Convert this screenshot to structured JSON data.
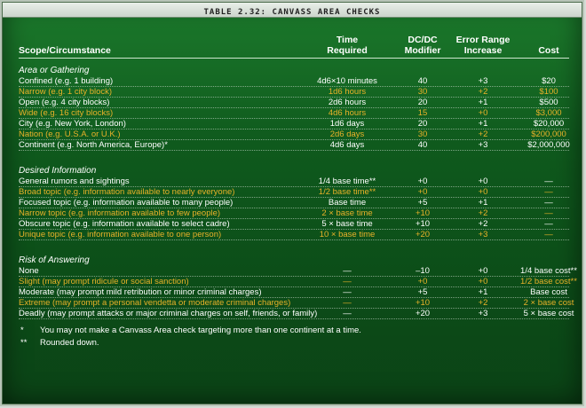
{
  "title": "TABLE 2.32: CANVASS AREA CHECKS",
  "headers": [
    [
      "Scope/Circumstance"
    ],
    [
      "Time",
      "Required"
    ],
    [
      "DC/DC",
      "Modifier"
    ],
    [
      "Error Range",
      "Increase"
    ],
    [
      "Cost"
    ]
  ],
  "sections": [
    {
      "title": "Area or Gathering",
      "rows": [
        [
          "Confined (e.g. 1 building)",
          "4d6×10 minutes",
          "40",
          "+3",
          "$20"
        ],
        [
          "Narrow (e.g. 1 city block)",
          "1d6 hours",
          "30",
          "+2",
          "$100"
        ],
        [
          "Open (e.g. 4 city blocks)",
          "2d6 hours",
          "20",
          "+1",
          "$500"
        ],
        [
          "Wide (e.g. 16 city blocks)",
          "4d6 hours",
          "15",
          "+0",
          "$3,000"
        ],
        [
          "City (e.g. New York, London)",
          "1d6 days",
          "20",
          "+1",
          "$20,000"
        ],
        [
          "Nation (e.g. U.S.A. or U.K.)",
          "2d6 days",
          "30",
          "+2",
          "$200,000"
        ],
        [
          "Continent (e.g. North America, Europe)*",
          "4d6 days",
          "40",
          "+3",
          "$2,000,000"
        ]
      ]
    },
    {
      "title": "Desired Information",
      "rows": [
        [
          "General rumors and sightings",
          "1/4 base time**",
          "+0",
          "+0",
          "—"
        ],
        [
          "Broad topic (e.g. information available to nearly everyone)",
          "1/2 base time**",
          "+0",
          "+0",
          "—"
        ],
        [
          "Focused topic (e.g. information available to many people)",
          "Base time",
          "+5",
          "+1",
          "—"
        ],
        [
          "Narrow topic (e.g. information available to few people)",
          "2 × base time",
          "+10",
          "+2",
          "—"
        ],
        [
          "Obscure topic (e.g. information available to select cadre)",
          "5 × base time",
          "+10",
          "+2",
          "—"
        ],
        [
          "Unique topic (e.g. information available to one person)",
          "10 × base time",
          "+20",
          "+3",
          "—"
        ]
      ]
    },
    {
      "title": "Risk of Answering",
      "rows": [
        [
          "None",
          "—",
          "–10",
          "+0",
          "1/4 base cost**"
        ],
        [
          "Slight (may prompt ridicule or social sanction)",
          "—",
          "+0",
          "+0",
          "1/2 base cost**"
        ],
        [
          "Moderate (may prompt mild retribution or minor criminal charges)",
          "—",
          "+5",
          "+1",
          "Base cost"
        ],
        [
          "Extreme (may prompt a personal vendetta or moderate criminal charges)",
          "—",
          "+10",
          "+2",
          "2 × base cost"
        ],
        [
          "Deadly (may prompt attacks or major criminal charges on self, friends, or family)",
          "—",
          "+20",
          "+3",
          "5 × base cost"
        ]
      ]
    }
  ],
  "notes": [
    {
      "mark": "*",
      "text": "You may not make a Canvass Area check targeting more than one continent at a time."
    },
    {
      "mark": "**",
      "text": "Rounded down."
    }
  ],
  "colors": {
    "alt_row": "#e8b12a",
    "normal_row": "#ffffff",
    "panel": "#0f5a1d"
  }
}
